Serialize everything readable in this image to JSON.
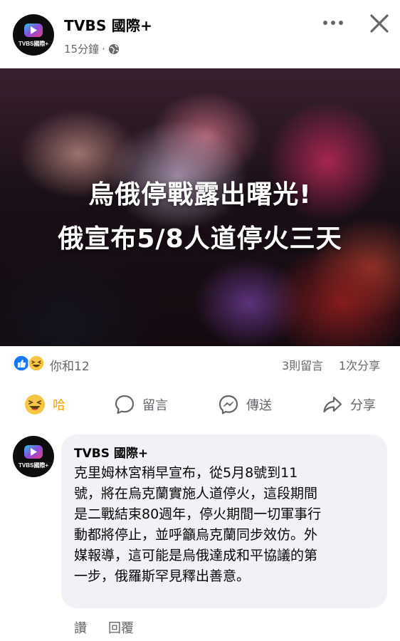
{
  "post": {
    "page_name": "TVBS 國際+",
    "time": "15分鐘",
    "separator": "·",
    "avatar_logo_text": "TVBS國際+"
  },
  "hero": {
    "line1": "烏俄停戰露出曙光!",
    "line2": "俄宣布5/8人道停火三天"
  },
  "stats": {
    "reactions_text": "你和12",
    "comments": "3則留言",
    "shares": "1次分享"
  },
  "actions": {
    "haha": "哈",
    "comment": "留言",
    "send": "傳送",
    "share": "分享"
  },
  "comment": {
    "author": "TVBS 國際+",
    "lines": [
      "克里姆林宮稍早宣布，從5月8號到11",
      "號，將在烏克蘭實施人道停火，這段期間",
      "是二戰結束80週年，停火期間一切軍事行",
      "動都將停止，並呼籲烏克蘭同步效仿。外",
      "媒報導，這可能是烏俄達成和平協議的第",
      "一步，俄羅斯罕見釋出善意。"
    ],
    "like": "讚",
    "reply": "回覆"
  },
  "colors": {
    "meta_gray": "#65676b",
    "haha_yellow": "#f0a30a",
    "like_blue": "#1877f2",
    "bubble_bg": "#f0f2f5"
  },
  "icons": [
    "tvbs-logo-icon",
    "globe-icon",
    "more-icon",
    "close-icon",
    "like-reaction-icon",
    "haha-reaction-icon",
    "comment-icon",
    "messenger-icon",
    "share-icon"
  ]
}
